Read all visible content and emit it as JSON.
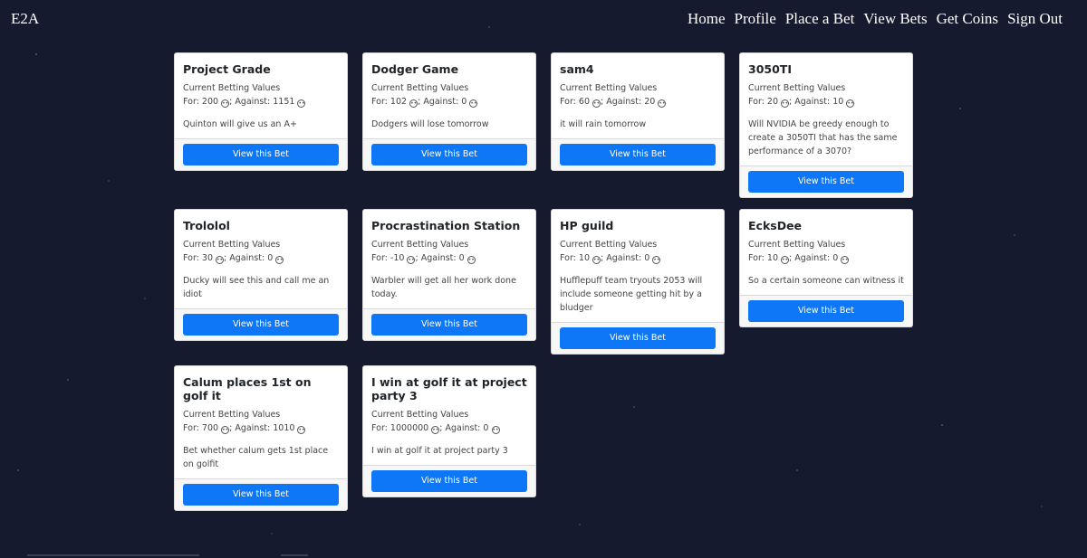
{
  "nav": {
    "brand": "E2A",
    "links": [
      "Home",
      "Profile",
      "Place a Bet",
      "View Bets",
      "Get Coins",
      "Sign Out"
    ]
  },
  "labels": {
    "sub": "Current Betting Values",
    "for": "For:",
    "against": "Against:",
    "button": "View this Bet"
  },
  "cards": [
    {
      "title": "Project Grade",
      "for": "200",
      "against": "1151",
      "desc": "Quinton will give us an A+"
    },
    {
      "title": "Dodger Game",
      "for": "102",
      "against": "0",
      "desc": "Dodgers will lose tomorrow"
    },
    {
      "title": "sam4",
      "for": "60",
      "against": "20",
      "desc": "it will rain tomorrow"
    },
    {
      "title": "3050TI",
      "for": "20",
      "against": "10",
      "desc": "Will NVIDIA be greedy enough to create a 3050TI that has the same performance of a 3070?"
    },
    {
      "title": "Trololol",
      "for": "30",
      "against": "0",
      "desc": "Ducky will see this and call me an idiot"
    },
    {
      "title": "Procrastination Station",
      "for": "-10",
      "against": "0",
      "desc": "Warbler will get all her work done today."
    },
    {
      "title": "HP guild",
      "for": "10",
      "against": "0",
      "desc": "Hufflepuff team tryouts 2053 will include someone getting hit by a bludger"
    },
    {
      "title": "EcksDee",
      "for": "10",
      "against": "0",
      "desc": "So a certain someone can witness it"
    },
    {
      "title": "Calum places 1st on golf it",
      "for": "700",
      "against": "1010",
      "desc": "Bet whether calum gets 1st place on golfit"
    },
    {
      "title": "I win at golf it at project party 3",
      "for": "1000000",
      "against": "0",
      "desc": "I win at golf it at project party 3"
    }
  ],
  "colors": {
    "background": "#161a2e",
    "button": "#0d77f7"
  },
  "icons": {
    "coin": "neutral-face-icon"
  }
}
